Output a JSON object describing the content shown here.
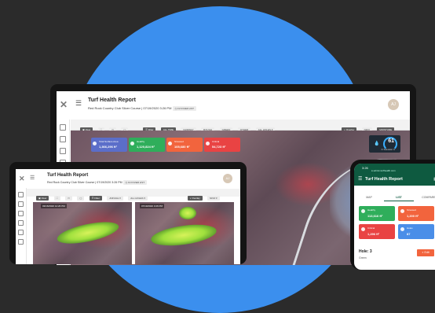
{
  "colors": {
    "circle": "#3b8fee",
    "background": "#2b2b2b",
    "brand_green": "#0e5a40",
    "stat_total": "#5b6ec9",
    "stat_healthy": "#2fae5b",
    "stat_stressed": "#f2643d",
    "stat_critical": "#e94343",
    "stat_info": "#4a8ee8"
  },
  "laptop": {
    "logo": "✕",
    "title": "Turf Health Report",
    "subtitle": "Red Rock Country Club Silver Course | 07/19/2020 3:26 PM",
    "subtitle_chip": "◷ FLYOVER LIST",
    "avatar": "AJ",
    "toolbar_left": [
      "▣ View",
      "⛶",
      "▭",
      "▢"
    ],
    "toolbar_mid": [
      "☰ Filter",
      "ALL TIME",
      "FAIRWAY",
      "ROUGH",
      "GREEN",
      "OTHER",
      "ALL HOLES ▾"
    ],
    "toolbar_right": [
      "◐ Overlay",
      "NDVI",
      "MOISTURE",
      "TEMPERATURE",
      "NDRE"
    ],
    "stats": [
      {
        "label": "Total Surface Area",
        "value": "1,366,296 ft²"
      },
      {
        "label": "Healthy",
        "value": "1,120,824 ft²"
      },
      {
        "label": "Stressed",
        "value": "105,680 ft²"
      },
      {
        "label": "Critical",
        "value": "54,723 ft²"
      }
    ],
    "gauge_value": "61",
    "gauge_caption": "Fr Saturation %"
  },
  "tablet": {
    "logo": "✕",
    "title": "Turf Health Report",
    "subtitle": "Red Rock Country Club Silver Course | 07/19/2020 3:26 PM",
    "subtitle_chip": "◷ FLYOVER LIST",
    "avatar": "AJ",
    "toolbar_left": [
      "▣ View",
      "⛶",
      "▭",
      "▢"
    ],
    "toolbar_mid": [
      "☰ Filter",
      "ANNUAL ▾",
      "ALL HOLES ▾"
    ],
    "toolbar_right": [
      "◐ Overlay",
      "NDVI ▾"
    ],
    "date_left": "03/16/2020 12:26 PM",
    "date_right": "07/19/2020 3:26 PM"
  },
  "phone": {
    "time": "3:26",
    "url": "●  admin.turfhealth.com",
    "title": "Turf Health Report",
    "tabs": [
      "MAP",
      "LIST",
      "COMPARE"
    ],
    "active_tab": "LIST",
    "cards": [
      {
        "label": "Healthy",
        "value": "113,616 ft²"
      },
      {
        "label": "Stressed",
        "value": "1,200 ft²"
      },
      {
        "label": "Critical",
        "value": "1,296 ft²"
      },
      {
        "label": "Holes",
        "value": "87"
      }
    ],
    "hole": "Hole: 3",
    "hole_sub": "Green",
    "button": "◐ Edit"
  }
}
